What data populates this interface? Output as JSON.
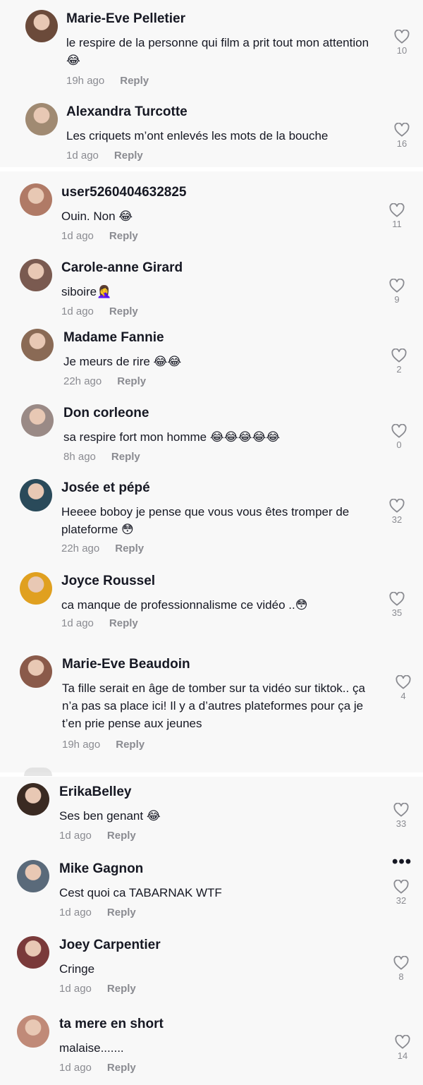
{
  "comments": [
    {
      "name": "Marie-Eve Pelletier",
      "text": "le respire de la personne qui film a prit tout mon attention 😂",
      "time": "19h ago",
      "reply": "Reply",
      "likes": "10",
      "avatar_color": "#6b4a3a"
    },
    {
      "name": "Alexandra Turcotte",
      "text": "Les criquets m’ont enlevés les mots de la bouche",
      "time": "1d ago",
      "reply": "Reply",
      "likes": "16",
      "avatar_color": "#a08a72"
    },
    {
      "name": "user5260404632825",
      "text": "Ouin. Non 😂",
      "time": "1d ago",
      "reply": "Reply",
      "likes": "11",
      "avatar_color": "#b07a66"
    },
    {
      "name": "Carole-anne Girard",
      "text": "siboire🤦‍♀️",
      "time": "1d ago",
      "reply": "Reply",
      "likes": "9",
      "avatar_color": "#7a5a50"
    },
    {
      "name": "Madame Fannie",
      "text": "Je meurs de rire 😂😂",
      "time": "22h ago",
      "reply": "Reply",
      "likes": "2",
      "avatar_color": "#8a6a55"
    },
    {
      "name": "Don corleone",
      "text": "sa respire fort mon homme 😂😂😂😂😂",
      "time": "8h ago",
      "reply": "Reply",
      "likes": "0",
      "avatar_color": "#9a8a86"
    },
    {
      "name": "Josée et pépé",
      "text": "Heeee boboy je pense que vous vous êtes tromper de plateforme 😳",
      "time": "22h ago",
      "reply": "Reply",
      "likes": "32",
      "avatar_color": "#2a4a5a"
    },
    {
      "name": "Joyce Roussel",
      "text": "ca manque de professionnalisme ce vidéo ..😳",
      "time": "1d ago",
      "reply": "Reply",
      "likes": "35",
      "avatar_color": "#e0a020"
    },
    {
      "name": "Marie-Eve Beaudoin",
      "text": "Ta fille serait en âge de tomber sur ta vidéo sur tiktok.. ça n’a pas sa place ici! Il y a d’autres plateformes pour ça je t’en prie pense aux jeunes",
      "time": "19h ago",
      "reply": "Reply",
      "likes": "4",
      "avatar_color": "#8a5a4a"
    },
    {
      "name": "ErikaBelley",
      "text": "Ses ben genant 😂",
      "time": "1d ago",
      "reply": "Reply",
      "likes": "33",
      "avatar_color": "#3a2a22"
    },
    {
      "name": "Mike Gagnon",
      "text": "Cest quoi ca TABARNAK WTF",
      "time": "1d ago",
      "reply": "Reply",
      "likes": "32",
      "avatar_color": "#5a6a7a"
    },
    {
      "name": "Joey Carpentier",
      "text": "Cringe",
      "time": "1d ago",
      "reply": "Reply",
      "likes": "8",
      "avatar_color": "#7a3a3a"
    },
    {
      "name": "ta mere en short",
      "text": "malaise.......",
      "time": "1d ago",
      "reply": "Reply",
      "likes": "14",
      "avatar_color": "#c08a78"
    }
  ],
  "more_glyph": "•••"
}
